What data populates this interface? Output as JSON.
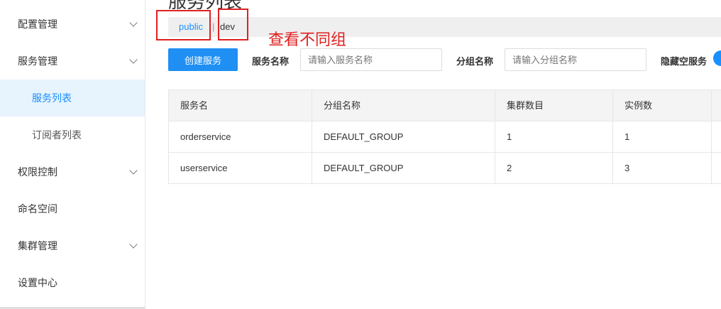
{
  "sidebar": {
    "items": [
      {
        "label": "配置管理",
        "expandable": true
      },
      {
        "label": "服务管理",
        "expandable": true
      },
      {
        "label": "服务列表",
        "sub": true,
        "active": true
      },
      {
        "label": "订阅者列表",
        "sub": true
      },
      {
        "label": "权限控制",
        "expandable": true
      },
      {
        "label": "命名空间"
      },
      {
        "label": "集群管理",
        "expandable": true
      },
      {
        "label": "设置中心"
      }
    ]
  },
  "page": {
    "title": "服务列表"
  },
  "namespaces": {
    "public": "public",
    "separator": "|",
    "dev": "dev"
  },
  "annotation": {
    "text": "查看不同组"
  },
  "toolbar": {
    "create_label": "创建服务",
    "service_name_label": "服务名称",
    "service_name_placeholder": "请输入服务名称",
    "group_name_label": "分组名称",
    "group_name_placeholder": "请输入分组名称",
    "hide_empty_label": "隐藏空服务"
  },
  "table": {
    "headers": [
      "服务名",
      "分组名称",
      "集群数目",
      "实例数"
    ],
    "rows": [
      [
        "orderservice",
        "DEFAULT_GROUP",
        "1",
        "1"
      ],
      [
        "userservice",
        "DEFAULT_GROUP",
        "2",
        "3"
      ]
    ]
  },
  "colors": {
    "accent": "#1890ff",
    "annotation": "#e02020",
    "active_bg": "#e7f3fd"
  }
}
